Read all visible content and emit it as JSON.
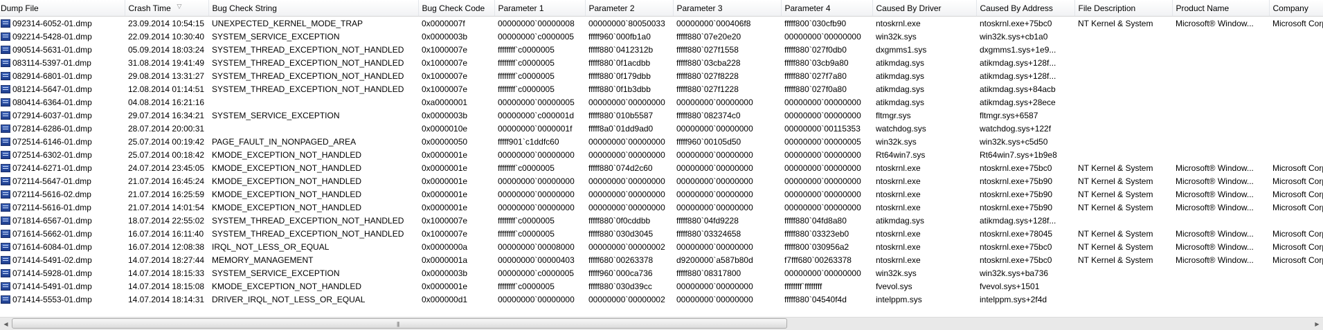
{
  "columns": [
    "Dump File",
    "Crash Time",
    "Bug Check String",
    "Bug Check Code",
    "Parameter 1",
    "Parameter 2",
    "Parameter 3",
    "Parameter 4",
    "Caused By Driver",
    "Caused By Address",
    "File Description",
    "Product Name",
    "Company"
  ],
  "sort_indicator": "▽",
  "icon": "dump-file-icon",
  "rows": [
    [
      "092314-6052-01.dmp",
      "23.09.2014 10:54:15",
      "UNEXPECTED_KERNEL_MODE_TRAP",
      "0x0000007f",
      "00000000`00000008",
      "00000000`80050033",
      "00000000`000406f8",
      "fffff800`030cfb90",
      "ntoskrnl.exe",
      "ntoskrnl.exe+75bc0",
      "NT Kernel & System",
      "Microsoft® Window...",
      "Microsoft Corpora..."
    ],
    [
      "092214-5428-01.dmp",
      "22.09.2014 10:30:40",
      "SYSTEM_SERVICE_EXCEPTION",
      "0x0000003b",
      "00000000`c0000005",
      "fffff960`000fb1a0",
      "fffff880`07e20e20",
      "00000000`00000000",
      "win32k.sys",
      "win32k.sys+cb1a0",
      "",
      "",
      ""
    ],
    [
      "090514-5631-01.dmp",
      "05.09.2014 18:03:24",
      "SYSTEM_THREAD_EXCEPTION_NOT_HANDLED",
      "0x1000007e",
      "ffffffff`c0000005",
      "fffff880`0412312b",
      "fffff880`027f1558",
      "fffff880`027f0db0",
      "dxgmms1.sys",
      "dxgmms1.sys+1e9...",
      "",
      "",
      ""
    ],
    [
      "083114-5397-01.dmp",
      "31.08.2014 19:41:49",
      "SYSTEM_THREAD_EXCEPTION_NOT_HANDLED",
      "0x1000007e",
      "ffffffff`c0000005",
      "fffff880`0f1acdbb",
      "fffff880`03cba228",
      "fffff880`03cb9a80",
      "atikmdag.sys",
      "atikmdag.sys+128f...",
      "",
      "",
      ""
    ],
    [
      "082914-6801-01.dmp",
      "29.08.2014 13:31:27",
      "SYSTEM_THREAD_EXCEPTION_NOT_HANDLED",
      "0x1000007e",
      "ffffffff`c0000005",
      "fffff880`0f179dbb",
      "fffff880`027f8228",
      "fffff880`027f7a80",
      "atikmdag.sys",
      "atikmdag.sys+128f...",
      "",
      "",
      ""
    ],
    [
      "081214-5647-01.dmp",
      "12.08.2014 01:14:51",
      "SYSTEM_THREAD_EXCEPTION_NOT_HANDLED",
      "0x1000007e",
      "ffffffff`c0000005",
      "fffff880`0f1b3dbb",
      "fffff880`027f1228",
      "fffff880`027f0a80",
      "atikmdag.sys",
      "atikmdag.sys+84acb",
      "",
      "",
      ""
    ],
    [
      "080414-6364-01.dmp",
      "04.08.2014 16:21:16",
      "",
      "0xa0000001",
      "00000000`00000005",
      "00000000`00000000",
      "00000000`00000000",
      "00000000`00000000",
      "atikmdag.sys",
      "atikmdag.sys+28ece",
      "",
      "",
      ""
    ],
    [
      "072914-6037-01.dmp",
      "29.07.2014 16:34:21",
      "SYSTEM_SERVICE_EXCEPTION",
      "0x0000003b",
      "00000000`c000001d",
      "fffff880`010b5587",
      "fffff880`082374c0",
      "00000000`00000000",
      "fltmgr.sys",
      "fltmgr.sys+6587",
      "",
      "",
      ""
    ],
    [
      "072814-6286-01.dmp",
      "28.07.2014 20:00:31",
      "",
      "0x0000010e",
      "00000000`0000001f",
      "fffff8a0`01dd9ad0",
      "00000000`00000000",
      "00000000`00115353",
      "watchdog.sys",
      "watchdog.sys+122f",
      "",
      "",
      ""
    ],
    [
      "072514-6146-01.dmp",
      "25.07.2014 00:19:42",
      "PAGE_FAULT_IN_NONPAGED_AREA",
      "0x00000050",
      "fffff901`c1ddfc60",
      "00000000`00000000",
      "fffff960`00105d50",
      "00000000`00000005",
      "win32k.sys",
      "win32k.sys+c5d50",
      "",
      "",
      ""
    ],
    [
      "072514-6302-01.dmp",
      "25.07.2014 00:18:42",
      "KMODE_EXCEPTION_NOT_HANDLED",
      "0x0000001e",
      "00000000`00000000",
      "00000000`00000000",
      "00000000`00000000",
      "00000000`00000000",
      "Rt64win7.sys",
      "Rt64win7.sys+1b9e8",
      "",
      "",
      ""
    ],
    [
      "072414-6271-01.dmp",
      "24.07.2014 23:45:05",
      "KMODE_EXCEPTION_NOT_HANDLED",
      "0x0000001e",
      "ffffffff`c0000005",
      "fffff880`074d2c60",
      "00000000`00000000",
      "00000000`00000000",
      "ntoskrnl.exe",
      "ntoskrnl.exe+75bc0",
      "NT Kernel & System",
      "Microsoft® Window...",
      "Microsoft Corpora..."
    ],
    [
      "072114-5647-01.dmp",
      "21.07.2014 16:45:24",
      "KMODE_EXCEPTION_NOT_HANDLED",
      "0x0000001e",
      "00000000`00000000",
      "00000000`00000000",
      "00000000`00000000",
      "00000000`00000000",
      "ntoskrnl.exe",
      "ntoskrnl.exe+75b90",
      "NT Kernel & System",
      "Microsoft® Window...",
      "Microsoft Corpora..."
    ],
    [
      "072114-5616-02.dmp",
      "21.07.2014 16:25:59",
      "KMODE_EXCEPTION_NOT_HANDLED",
      "0x0000001e",
      "00000000`00000000",
      "00000000`00000000",
      "00000000`00000000",
      "00000000`00000000",
      "ntoskrnl.exe",
      "ntoskrnl.exe+75b90",
      "NT Kernel & System",
      "Microsoft® Window...",
      "Microsoft Corpora..."
    ],
    [
      "072114-5616-01.dmp",
      "21.07.2014 14:01:54",
      "KMODE_EXCEPTION_NOT_HANDLED",
      "0x0000001e",
      "00000000`00000000",
      "00000000`00000000",
      "00000000`00000000",
      "00000000`00000000",
      "ntoskrnl.exe",
      "ntoskrnl.exe+75b90",
      "NT Kernel & System",
      "Microsoft® Window...",
      "Microsoft Corpora..."
    ],
    [
      "071814-6567-01.dmp",
      "18.07.2014 22:55:02",
      "SYSTEM_THREAD_EXCEPTION_NOT_HANDLED",
      "0x1000007e",
      "ffffffff`c0000005",
      "fffff880`0f0cddbb",
      "fffff880`04fd9228",
      "fffff880`04fd8a80",
      "atikmdag.sys",
      "atikmdag.sys+128f...",
      "",
      "",
      ""
    ],
    [
      "071614-5662-01.dmp",
      "16.07.2014 16:11:40",
      "SYSTEM_THREAD_EXCEPTION_NOT_HANDLED",
      "0x1000007e",
      "ffffffff`c0000005",
      "fffff880`030d3045",
      "fffff880`03324658",
      "fffff880`03323eb0",
      "ntoskrnl.exe",
      "ntoskrnl.exe+78045",
      "NT Kernel & System",
      "Microsoft® Window...",
      "Microsoft Corpora..."
    ],
    [
      "071614-6084-01.dmp",
      "16.07.2014 12:08:38",
      "IRQL_NOT_LESS_OR_EQUAL",
      "0x0000000a",
      "00000000`00008000",
      "00000000`00000002",
      "00000000`00000000",
      "fffff800`030956a2",
      "ntoskrnl.exe",
      "ntoskrnl.exe+75bc0",
      "NT Kernel & System",
      "Microsoft® Window...",
      "Microsoft Corpora..."
    ],
    [
      "071414-5491-02.dmp",
      "14.07.2014 18:27:44",
      "MEMORY_MANAGEMENT",
      "0x0000001a",
      "00000000`00000403",
      "fffff680`00263378",
      "d9200000`a587b80d",
      "f7fff680`00263378",
      "ntoskrnl.exe",
      "ntoskrnl.exe+75bc0",
      "NT Kernel & System",
      "Microsoft® Window...",
      "Microsoft Corpora..."
    ],
    [
      "071414-5928-01.dmp",
      "14.07.2014 18:15:33",
      "SYSTEM_SERVICE_EXCEPTION",
      "0x0000003b",
      "00000000`c0000005",
      "fffff960`000ca736",
      "fffff880`08317800",
      "00000000`00000000",
      "win32k.sys",
      "win32k.sys+ba736",
      "",
      "",
      ""
    ],
    [
      "071414-5491-01.dmp",
      "14.07.2014 18:15:08",
      "KMODE_EXCEPTION_NOT_HANDLED",
      "0x0000001e",
      "ffffffff`c0000005",
      "fffff880`030d39cc",
      "00000000`00000000",
      "ffffffff`ffffffff",
      "fvevol.sys",
      "fvevol.sys+1501",
      "",
      "",
      ""
    ],
    [
      "071414-5553-01.dmp",
      "14.07.2014 18:14:31",
      "DRIVER_IRQL_NOT_LESS_OR_EQUAL",
      "0x000000d1",
      "00000000`00000000",
      "00000000`00000002",
      "00000000`00000000",
      "fffff880`04540f4d",
      "intelppm.sys",
      "intelppm.sys+2f4d",
      "",
      "",
      ""
    ]
  ],
  "scrollbar": {
    "left_arrow": "left-arrow-icon",
    "right_arrow": "right-arrow-icon",
    "grip": "grip-icon"
  }
}
